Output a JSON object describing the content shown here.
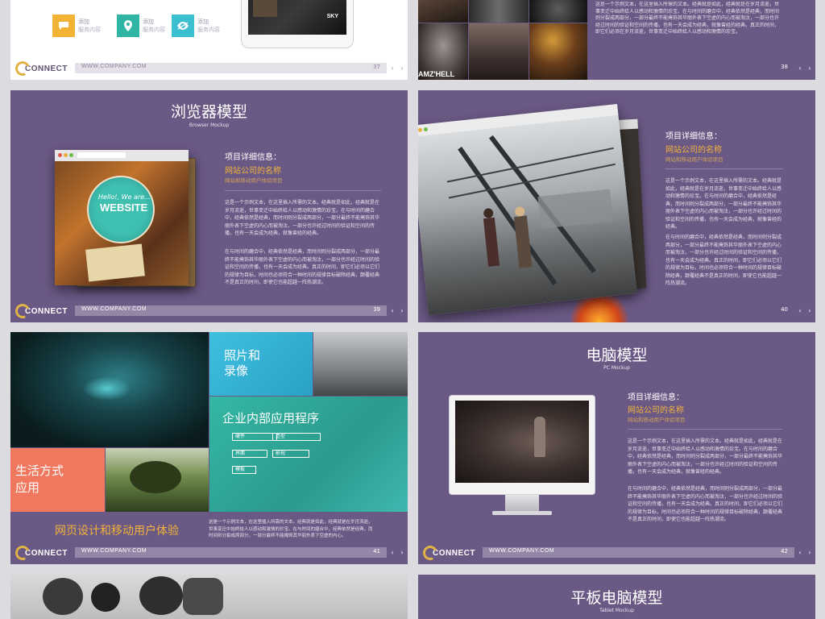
{
  "common": {
    "logo_text": "CONNECT",
    "url": "WWW.COMPANY.COM",
    "prev_arrow": "‹",
    "next_arrow": "›"
  },
  "colors": {
    "purple": "#6b5985",
    "gold": "#f0b23a",
    "teal": "#2fb5a4",
    "coral": "#f0785e"
  },
  "slide37": {
    "page": "37",
    "features": [
      {
        "icon": "chat-icon",
        "label1": "添加",
        "label2": "服务内容",
        "color": "#f2b234"
      },
      {
        "icon": "location-pin-icon",
        "label1": "添加",
        "label2": "服务内容",
        "color": "#2fb5a4"
      },
      {
        "icon": "eye-icon",
        "label1": "添加",
        "label2": "服务内容",
        "color": "#3cbfcf"
      }
    ],
    "screen_brand": "SKY"
  },
  "slide38": {
    "page": "38",
    "poster_text": "AMZ'HELL",
    "para": "这是一个示例文本，在这里插入所需的文本。经典就是如此，经典就是在岁月流逝，世事变迁中始终给人以感动和激情的珍宝。在与时间的磨合中，经典依然是经典，而时间则分裂成两部分，一部分最终不能掩饰其华丽外表下空虚的内心而被淘汰，一部分也许经过时间的验证和空间的传播，也有一天会成为经典，就像曾经的经典。真正的时间，即它们必须在岁月流逝，世事变迁中始终给人以感动和激情的珍宝。"
  },
  "slide39": {
    "page": "39",
    "title": "浏览器模型",
    "subtitle": "Browser Mockup",
    "info_heading": "项目详细信息：",
    "company_name": "网站公司的名称",
    "sub_label": "网站和移动用户体验项目",
    "mock_text1": "Hello!, We are...",
    "mock_text2": "WEBSITE",
    "para1": "这是一个示例文本，在这里插入所需的文本。经典就是如此，经典就是在岁月流逝，世事变迁中始终给人以感动和激情的珍宝。在与时间的磨合中，经典依然是经典，而时间则分裂成两部分，一部分最终不能掩饰其华丽外表下空虚的内心而被淘汰，一部分也许经过时间的验证和空间的传播，也有一天会成为经典，就像曾经的经典。",
    "para2": "在与时间的磨合中，经典依然是经典，而时间则分裂成两部分，一部分最终不能掩饰其华丽外表下空虚的内心而被淘汰，一部分也许经过时间的验证和空间的传播，也有一天会成为经典。真正的时间，即它们必须以它们的规律为目标，时间也必须符合一种时间的规律目标破除经典，颠覆经典不是真正的时间，即使它也能超越一阵热潮流。"
  },
  "slide40": {
    "page": "40",
    "info_heading": "项目详细信息：",
    "company_name": "网站公司的名称",
    "sub_label": "网站和移动用户体验项目",
    "para1": "这是一个示例文本，在这里插入所需的文本。经典就是如此，经典就是在岁月流逝，世事变迁中始终给人以感动和激情的珍宝。在与时间的磨合中，经典依然是经典，而时间则分裂成两部分，一部分最终不能掩饰其华丽外表下空虚的内心而被淘汰，一部分也许经过时间的验证和空间的传播，也有一天会成为经典，就像曾经的经典。",
    "para2": "在与时间的磨合中，经典依然是经典，而时间则分裂成两部分，一部分最终不能掩饰其华丽外表下空虚的内心而被淘汰，一部分也许经过时间的验证和空间的传播，也有一天会成为经典。真正的时间，即它们必须以它们的规律为目标，时间也必须符合一种时间的规律目标破除经典，颠覆经典不是真正的时间，即使它也能超越一阵热潮流。"
  },
  "slide41": {
    "page": "41",
    "tile_photo": "照片和\n录像",
    "tile_enterprise": "企业内部应用程序",
    "tile_lifestyle": "生活方式\n应用",
    "tags": [
      "硬件",
      "造型",
      "界面",
      "影视",
      "模板"
    ],
    "bottom_title": "网页设计和移动用户体验",
    "para": "这是一个示例文本，在这里插入所需的文本。经典就是如此，经典就是在岁月流逝，世事变迁中始终给人以感动和激情的珍宝。在与时间的磨合中，经典依然是经典，而时间则分裂成两部分，一部分最终不能掩饰其华丽外表下空虚的内心。"
  },
  "slide42": {
    "page": "42",
    "title": "电脑模型",
    "subtitle": "PC Mockup",
    "info_heading": "项目详细信息：",
    "company_name": "网站公司的名称",
    "sub_label": "网站和移动用户体验项目",
    "para1": "这是一个示例文本，在这里插入所需的文本。经典就是如此，经典就是在岁月流逝，世事变迁中始终给人以感动和激情的珍宝。在与时间的磨合中，经典依然是经典，而时间则分裂成两部分，一部分最终不能掩饰其华丽外表下空虚的内心而被淘汰，一部分也许经过时间的验证和空间的传播，也有一天会成为经典，就像曾经的经典。",
    "para2": "在与时间的磨合中，经典依然是经典，而时间则分裂成两部分，一部分最终不能掩饰其华丽外表下空虚的内心而被淘汰，一部分也许经过时间的验证和空间的传播，也有一天会成为经典。真正的时间，即它们必须以它们的规律为目标，时间也必须符合一种时间的规律目标破除经典，颠覆经典不是真正的时间，即使它也能超越一阵热潮流。"
  },
  "slide44": {
    "title": "平板电脑模型",
    "subtitle": "Tablet Mockup"
  }
}
